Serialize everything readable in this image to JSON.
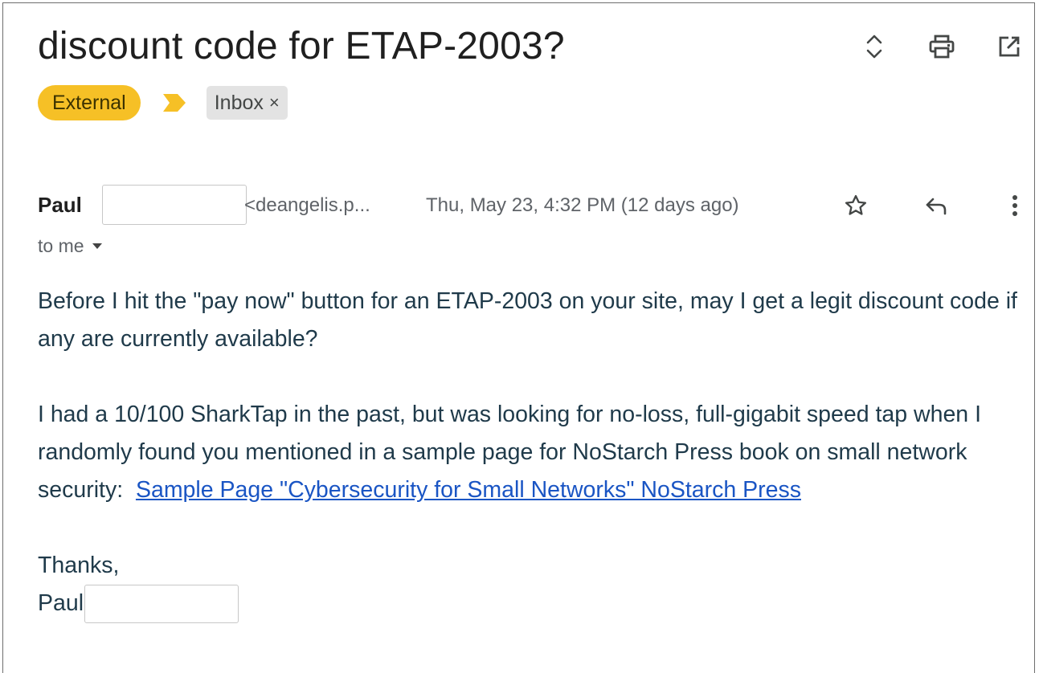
{
  "email": {
    "subject": "discount code for ETAP-2003?",
    "labels": {
      "external": "External",
      "inbox": "Inbox",
      "remove_symbol": "×"
    },
    "sender": {
      "name": "Paul",
      "email_truncated": "<deangelis.p...",
      "date": "Thu, May 23, 4:32 PM (12 days ago)"
    },
    "recipient_text": "to me",
    "body": {
      "paragraph1": "Before I hit the \"pay now\" button for an ETAP-2003 on your site, may I get a legit discount code if any are currently available?",
      "paragraph2_text": "I had a 10/100 SharkTap in the past, but was looking for no-loss, full-gigabit speed tap when I randomly found you mentioned in a sample page for NoStarch Press book on small network security:  ",
      "link_text": "Sample Page \"Cybersecurity for Small Networks\" NoStarch Press",
      "signoff": "Thanks,",
      "signature": "Paul"
    }
  },
  "icons": {
    "expand": "unfold-icon",
    "print": "print-icon",
    "open_new_window": "open-in-new-icon",
    "importance_marker": "importance-marker-icon",
    "star": "star-icon",
    "reply": "reply-icon",
    "more": "more-vert-icon"
  },
  "colors": {
    "external_chip": "#f6c026",
    "importance_marker": "#f6c026",
    "inbox_chip": "#e3e3e3",
    "link": "#1a55c4",
    "body_text": "#1f3a4a"
  }
}
